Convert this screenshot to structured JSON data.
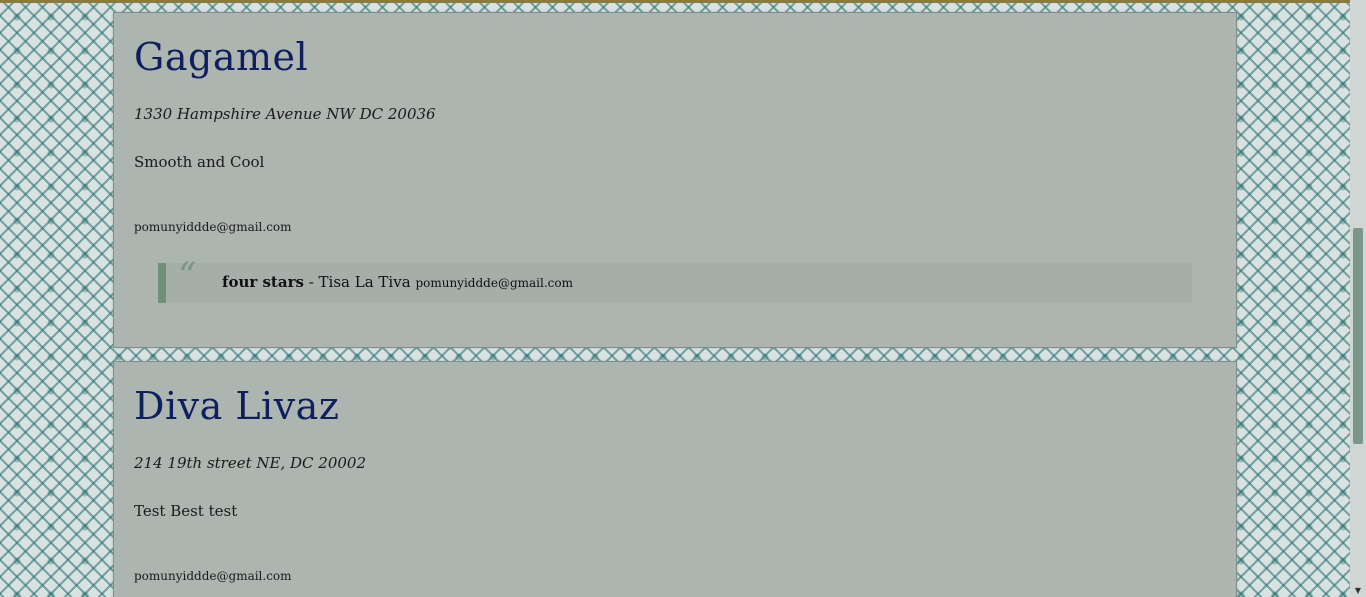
{
  "restaurants": [
    {
      "name": "Gagamel",
      "address": "1330 Hampshire Avenue NW DC 20036",
      "description": "Smooth and Cool",
      "email": "pomunyiddde@gmail.com",
      "review": {
        "quote_mark": "“",
        "rating": "four stars",
        "separator": " - ",
        "reviewer": "Tisa La Tiva",
        "reviewer_email": "pomunyiddde@gmail.com"
      }
    },
    {
      "name": "Diva Livaz",
      "address": "214 19th street NE, DC 20002",
      "description": "Test Best test",
      "email": "pomunyiddde@gmail.com"
    }
  ],
  "scrollbar": {
    "down_arrow": "▼"
  },
  "colors": {
    "title": "#0f1f5e",
    "card_bg": "#adb5b0",
    "review_accent": "#6f917a",
    "pattern": "#236e6e"
  }
}
